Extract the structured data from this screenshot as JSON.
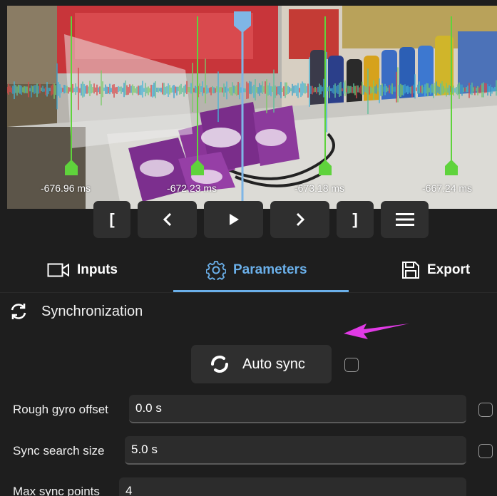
{
  "timeline": {
    "offsets": [
      "-676.96 ms",
      "-672.23 ms",
      "-673.18 ms",
      "-667.24 ms"
    ]
  },
  "transport": {
    "set_start": "[",
    "set_end": "]"
  },
  "tabs": [
    {
      "label": "Inputs",
      "icon": "video-camera-icon"
    },
    {
      "label": "Parameters",
      "icon": "gear-icon"
    },
    {
      "label": "Export",
      "icon": "save-icon"
    }
  ],
  "sync": {
    "section_title": "Synchronization",
    "autosync_label": "Auto sync"
  },
  "params": [
    {
      "label": "Rough gyro offset",
      "value": "0.0 s"
    },
    {
      "label": "Sync search size",
      "value": "5.0 s"
    },
    {
      "label": "Max sync points",
      "value": "4"
    }
  ],
  "colors": {
    "accent": "#6bb0ea",
    "marker": "#5fd33c",
    "annotation_arrow": "#e13ae6",
    "background": "#1e1e1e",
    "button": "#2f2f2f"
  }
}
